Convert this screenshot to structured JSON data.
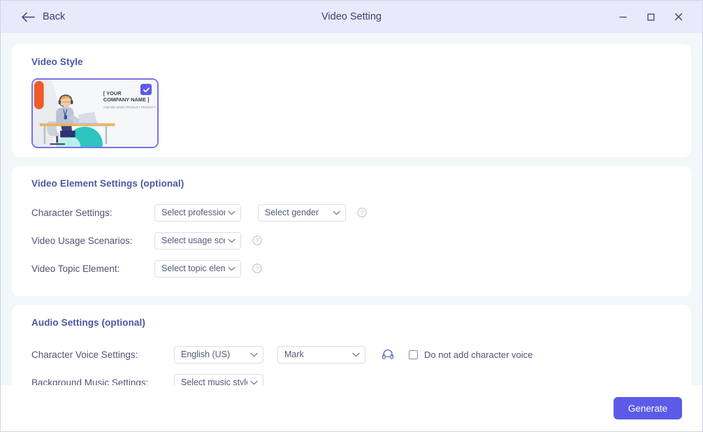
{
  "titlebar": {
    "back_label": "Back",
    "title": "Video Setting",
    "minimize_label": "Minimize",
    "maximize_label": "Maximize",
    "close_label": "Close"
  },
  "video_style": {
    "section_title": "Video Style",
    "selected": true,
    "thumbnail": {
      "company_line1": "[ YOUR",
      "company_line2": "COMPANY NAME ]",
      "tagline": "AND WE MAKE PRODUCT PRODUCT"
    }
  },
  "video_element": {
    "section_title": "Video Element Settings (optional)",
    "character_settings": {
      "label": "Character Settings:",
      "profession_value": "Select profession",
      "gender_value": "Select gender",
      "help": "?"
    },
    "usage_scenarios": {
      "label": "Video Usage Scenarios:",
      "value": "Select usage scena",
      "help": "?"
    },
    "topic_element": {
      "label": "Video Topic Element:",
      "value": "Select topic eleme",
      "help": "?"
    }
  },
  "audio": {
    "section_title": "Audio Settings (optional)",
    "voice_settings": {
      "label": "Character Voice Settings:",
      "language_value": "English (US)",
      "voice_value": "Mark",
      "preview_icon": "headphones-icon",
      "no_voice_checkbox_label": "Do not add character voice",
      "no_voice_checked": false
    },
    "music_settings": {
      "label": "Background Music Settings:",
      "value": "Select music style"
    }
  },
  "footer": {
    "generate_label": "Generate"
  },
  "colors": {
    "accent": "#5b5be8",
    "titlebar_bg": "#e8e9fb",
    "content_bg": "#f2f7fa",
    "section_title": "#4a56a6",
    "label_text": "#4e5575"
  }
}
